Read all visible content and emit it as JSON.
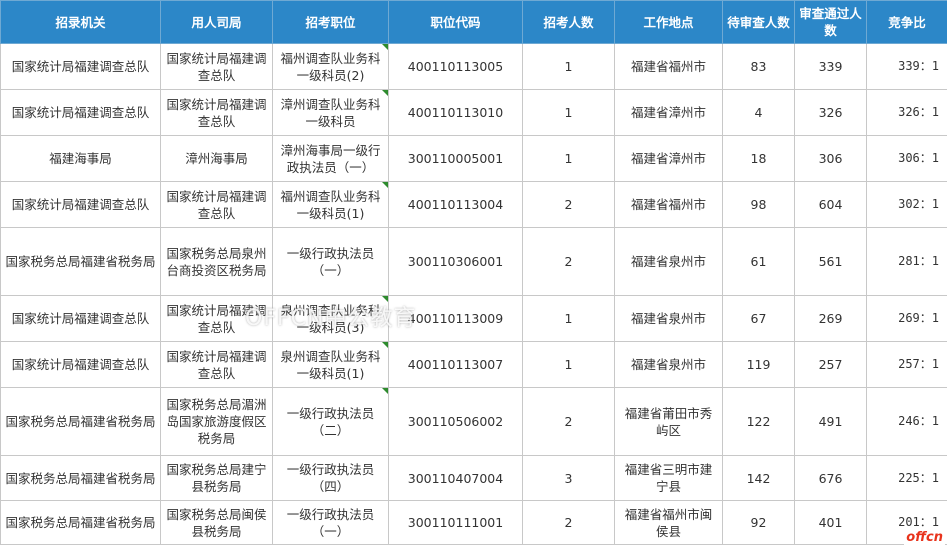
{
  "table": {
    "headers": [
      "招录机关",
      "用人司局",
      "招考职位",
      "职位代码",
      "招考人数",
      "工作地点",
      "待审查人数",
      "审查通过人数",
      "竞争比"
    ],
    "rows": [
      {
        "agency": "国家统计局福建调查总队",
        "dept": "国家统计局福建调查总队",
        "position": "福州调查队业务科一级科员(2)",
        "code": "400110113005",
        "count": "1",
        "location": "福建省福州市",
        "pending": "83",
        "passed": "339",
        "ratio": "339：1"
      },
      {
        "agency": "国家统计局福建调查总队",
        "dept": "国家统计局福建调查总队",
        "position": "漳州调查队业务科一级科员",
        "code": "400110113010",
        "count": "1",
        "location": "福建省漳州市",
        "pending": "4",
        "passed": "326",
        "ratio": "326：1"
      },
      {
        "agency": "福建海事局",
        "dept": "漳州海事局",
        "position": "漳州海事局一级行政执法员（一）",
        "code": "300110005001",
        "count": "1",
        "location": "福建省漳州市",
        "pending": "18",
        "passed": "306",
        "ratio": "306：1"
      },
      {
        "agency": "国家统计局福建调查总队",
        "dept": "国家统计局福建调查总队",
        "position": "福州调查队业务科一级科员(1)",
        "code": "400110113004",
        "count": "2",
        "location": "福建省福州市",
        "pending": "98",
        "passed": "604",
        "ratio": "302：1"
      },
      {
        "agency": "国家税务总局福建省税务局",
        "dept": "国家税务总局泉州台商投资区税务局",
        "position": "一级行政执法员（一）",
        "code": "300110306001",
        "count": "2",
        "location": "福建省泉州市",
        "pending": "61",
        "passed": "561",
        "ratio": "281：1"
      },
      {
        "agency": "国家统计局福建调查总队",
        "dept": "国家统计局福建调查总队",
        "position": "泉州调查队业务科一级科员(3)",
        "code": "400110113009",
        "count": "1",
        "location": "福建省泉州市",
        "pending": "67",
        "passed": "269",
        "ratio": "269：1"
      },
      {
        "agency": "国家统计局福建调查总队",
        "dept": "国家统计局福建调查总队",
        "position": "泉州调查队业务科一级科员(1)",
        "code": "400110113007",
        "count": "1",
        "location": "福建省泉州市",
        "pending": "119",
        "passed": "257",
        "ratio": "257：1"
      },
      {
        "agency": "国家税务总局福建省税务局",
        "dept": "国家税务总局湄洲岛国家旅游度假区税务局",
        "position": "一级行政执法员（二）",
        "code": "300110506002",
        "count": "2",
        "location": "福建省莆田市秀屿区",
        "pending": "122",
        "passed": "491",
        "ratio": "246：1"
      },
      {
        "agency": "国家税务总局福建省税务局",
        "dept": "国家税务总局建宁县税务局",
        "position": "一级行政执法员（四）",
        "code": "300110407004",
        "count": "3",
        "location": "福建省三明市建宁县",
        "pending": "142",
        "passed": "676",
        "ratio": "225：1"
      },
      {
        "agency": "国家税务总局福建省税务局",
        "dept": "国家税务总局闽侯县税务局",
        "position": "一级行政执法员（一）",
        "code": "300110111001",
        "count": "2",
        "location": "福建省福州市闽侯县",
        "pending": "92",
        "passed": "401",
        "ratio": "201：1"
      }
    ]
  },
  "watermark": "OFFCN中公教育",
  "logo": "offcn",
  "colors": {
    "header_bg": "#2c87c8",
    "header_text": "#ffffff",
    "flag": "#2e8b2e",
    "logo": "#e8331c"
  }
}
